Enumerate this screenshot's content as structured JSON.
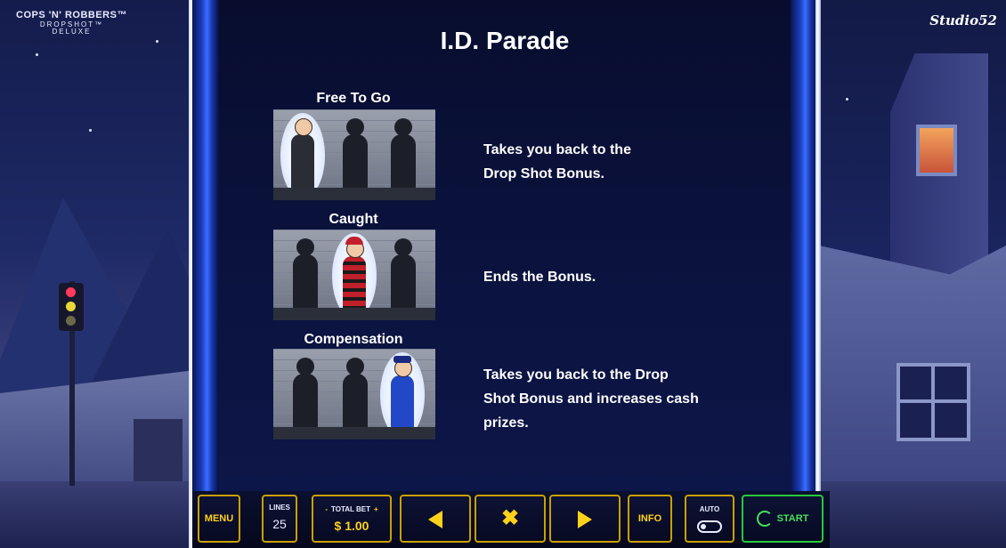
{
  "game": {
    "logo_left": {
      "line1": "COPS 'N' ROBBERS™",
      "line2": "DROPSHOT™",
      "line3": "DELUXE"
    },
    "logo_right": "Studio52"
  },
  "panel": {
    "title": "I.D. Parade",
    "items": [
      {
        "label": "Free To Go",
        "description_lines": [
          "Takes you back to the",
          "Drop Shot Bonus."
        ]
      },
      {
        "label": "Caught",
        "description_lines": [
          "Ends the Bonus."
        ]
      },
      {
        "label": "Compensation",
        "description_lines": [
          "Takes you back to the Drop",
          "Shot Bonus and increases cash",
          "prizes."
        ]
      }
    ]
  },
  "controls": {
    "menu": "MENU",
    "lines_label": "LINES",
    "lines_value": "25",
    "bet_minus": "-",
    "bet_label": "TOTAL BET",
    "bet_plus": "+",
    "bet_value": "$ 1.00",
    "prev_icon": "left-arrow-icon",
    "close_icon": "close-x-icon",
    "close_glyph": "✖",
    "next_icon": "right-arrow-icon",
    "info": "INFO",
    "auto_label": "AUTO",
    "start": "START"
  },
  "colors": {
    "accent": "#ffd21a",
    "start": "#46e05a",
    "panel": "#0b1340"
  }
}
